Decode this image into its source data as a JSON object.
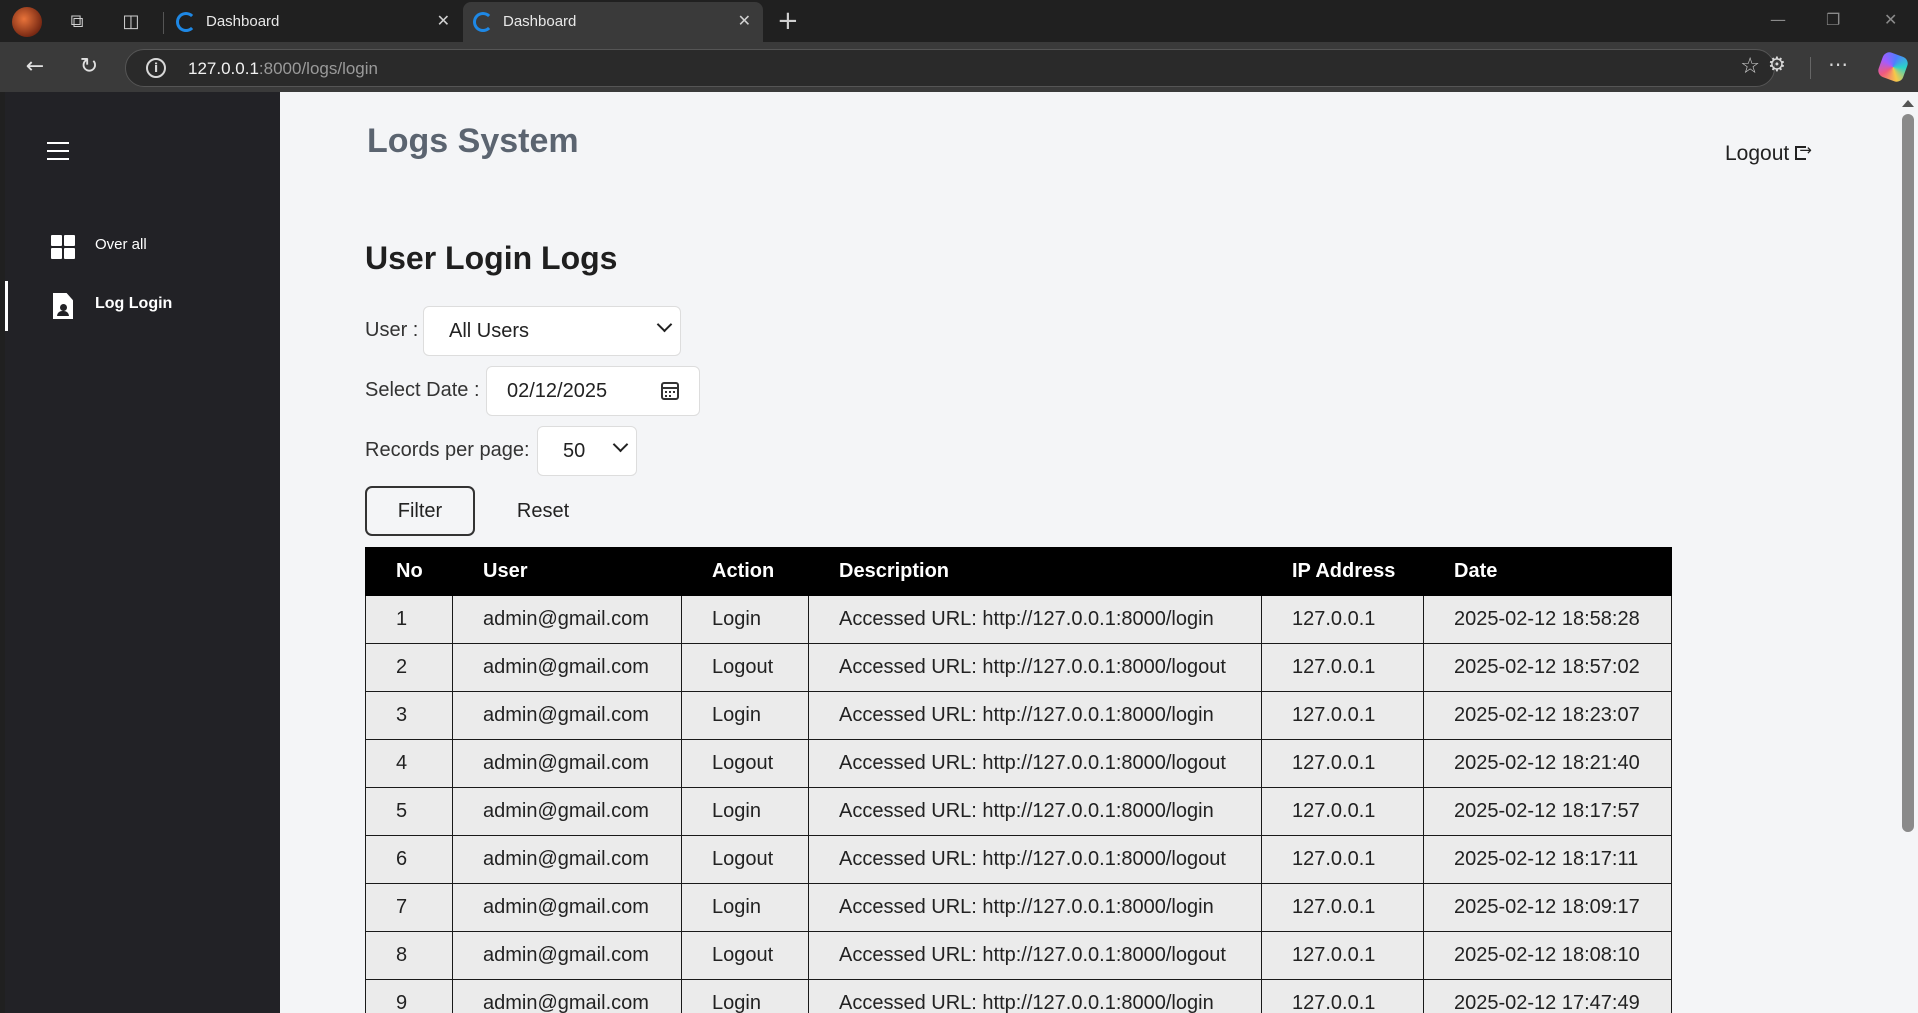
{
  "browser": {
    "tabs": [
      {
        "title": "Dashboard",
        "active": false
      },
      {
        "title": "Dashboard",
        "active": true
      }
    ],
    "url_host": "127.0.0.1",
    "url_rest": ":8000/logs/login",
    "icons": {
      "back": "back-arrow-icon",
      "reload": "reload-icon",
      "info": "info-icon",
      "favorite": "star-icon",
      "extensions": "puzzle-icon",
      "more": "ellipsis-icon",
      "copilot": "copilot-icon"
    }
  },
  "sidebar": {
    "items": [
      {
        "label": "Over all",
        "icon": "grid-icon",
        "active": false
      },
      {
        "label": "Log Login",
        "icon": "document-user-icon",
        "active": true
      }
    ]
  },
  "header": {
    "title": "Logs System",
    "logout_label": "Logout"
  },
  "page": {
    "title": "User Login Logs",
    "filters": {
      "user_label": "User :",
      "user_value": "All Users",
      "date_label": "Select Date :",
      "date_value": "02/12/2025",
      "per_page_label": "Records per page:",
      "per_page_value": "50"
    },
    "filter_button": "Filter",
    "reset_button": "Reset"
  },
  "table": {
    "columns": [
      "No",
      "User",
      "Action",
      "Description",
      "IP Address",
      "Date"
    ],
    "rows": [
      [
        "1",
        "admin@gmail.com",
        "Login",
        "Accessed URL: http://127.0.0.1:8000/login",
        "127.0.0.1",
        "2025-02-12 18:58:28"
      ],
      [
        "2",
        "admin@gmail.com",
        "Logout",
        "Accessed URL: http://127.0.0.1:8000/logout",
        "127.0.0.1",
        "2025-02-12 18:57:02"
      ],
      [
        "3",
        "admin@gmail.com",
        "Login",
        "Accessed URL: http://127.0.0.1:8000/login",
        "127.0.0.1",
        "2025-02-12 18:23:07"
      ],
      [
        "4",
        "admin@gmail.com",
        "Logout",
        "Accessed URL: http://127.0.0.1:8000/logout",
        "127.0.0.1",
        "2025-02-12 18:21:40"
      ],
      [
        "5",
        "admin@gmail.com",
        "Login",
        "Accessed URL: http://127.0.0.1:8000/login",
        "127.0.0.1",
        "2025-02-12 18:17:57"
      ],
      [
        "6",
        "admin@gmail.com",
        "Logout",
        "Accessed URL: http://127.0.0.1:8000/logout",
        "127.0.0.1",
        "2025-02-12 18:17:11"
      ],
      [
        "7",
        "admin@gmail.com",
        "Login",
        "Accessed URL: http://127.0.0.1:8000/login",
        "127.0.0.1",
        "2025-02-12 18:09:17"
      ],
      [
        "8",
        "admin@gmail.com",
        "Logout",
        "Accessed URL: http://127.0.0.1:8000/logout",
        "127.0.0.1",
        "2025-02-12 18:08:10"
      ],
      [
        "9",
        "admin@gmail.com",
        "Login",
        "Accessed URL: http://127.0.0.1:8000/login",
        "127.0.0.1",
        "2025-02-12 17:47:49"
      ]
    ]
  },
  "colors": {
    "sidebar_bg": "#222226",
    "content_bg": "#f4f5f7",
    "table_header_bg": "#000000",
    "table_row_bg": "#ebebeb",
    "title_color": "#5b6470"
  }
}
